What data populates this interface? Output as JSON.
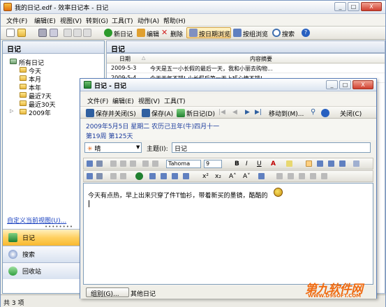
{
  "app": {
    "title": "我的日记.edf - 效率日记本 - 日记",
    "win_controls": [
      "_",
      "□",
      "X"
    ]
  },
  "menu": [
    "文件(F)",
    "编辑(E)",
    "视图(V)",
    "转到(G)",
    "工具(T)",
    "动作(A)",
    "帮助(H)"
  ],
  "toolbar": {
    "new": "新日记",
    "edit": "编辑",
    "delete": "删除",
    "by_date": "按日期浏览",
    "by_group": "按组浏览",
    "search": "搜索"
  },
  "left": {
    "header": "日记",
    "tree": {
      "root": "所有日记",
      "items": [
        "今天",
        "本月",
        "本年",
        "最近7天",
        "最近30天",
        "2009年"
      ]
    },
    "custom_view": "自定义当前视图(U)...",
    "dots": "••••••••",
    "nav": {
      "diary": "日记",
      "search": "搜索",
      "recycle": "回收站"
    }
  },
  "status": "共 3 项",
  "right": {
    "header": "日记",
    "columns": {
      "date": "日期",
      "sort": "△",
      "summary": "内容摘要"
    },
    "rows": [
      {
        "date": "2009-5-3",
        "summary": "今天是五一小长假的最后一天，我和小丽去购物..."
      },
      {
        "date": "2009-5-4",
        "summary": "今天天气不错! 小长假后第一天上班心情不错!"
      }
    ]
  },
  "dialog": {
    "title": "日记 - 日记",
    "menu": [
      "文件(F)",
      "编辑(E)",
      "视图(V)",
      "工具(T)"
    ],
    "toolbar": {
      "save_close": "保存并关闭(S)",
      "save": "保存(A)",
      "new": "新日记(D)",
      "move": "移动到(M)...",
      "close": "关闭(C)"
    },
    "date_line": "2009年5月5日 星期二 农历己丑年(牛)四月十一",
    "week_line": "第19周 第125天",
    "weather": "晴",
    "topic_label": "主题(I):",
    "topic_value": "日记",
    "font_name": "Tahoma",
    "font_size": "9",
    "fmt_labels": {
      "bold": "B",
      "italic": "I",
      "underline": "U",
      "color": "A",
      "superscript": "x²",
      "subscript": "x₂",
      "grow": "A˄",
      "shrink": "A˅"
    },
    "body": "今天有点热，早上出来只穿了件T恤衫，带着新买的墨镜，酷酷的",
    "group_button": "组别(G)...",
    "group_value": "其他日记"
  },
  "watermark": {
    "text": "第九软件网",
    "url": "WWW.D9SOFT.COM"
  }
}
